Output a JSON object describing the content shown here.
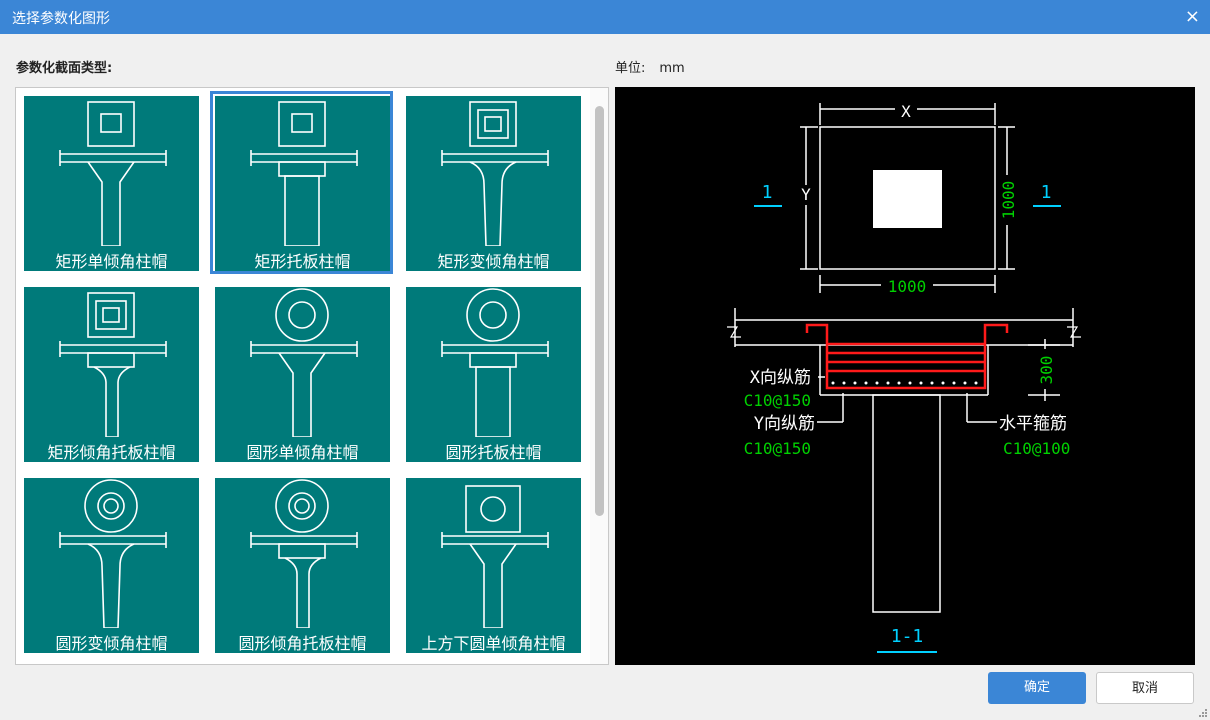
{
  "window": {
    "title": "选择参数化图形",
    "close_glyph": "×"
  },
  "section_label": "参数化截面类型:",
  "unit": {
    "label": "单位:",
    "value": "mm"
  },
  "tiles": [
    {
      "label": "矩形单倾角柱帽",
      "shape": "rect-tilt"
    },
    {
      "label": "矩形托板柱帽",
      "shape": "rect-plate",
      "selected": true
    },
    {
      "label": "矩形变倾角柱帽",
      "shape": "rect-vartilt"
    },
    {
      "label": "矩形倾角托板柱帽",
      "shape": "rect-tilt-plate"
    },
    {
      "label": "圆形单倾角柱帽",
      "shape": "circle-tilt"
    },
    {
      "label": "圆形托板柱帽",
      "shape": "circle-plate"
    },
    {
      "label": "圆形变倾角柱帽",
      "shape": "circle-vartilt"
    },
    {
      "label": "圆形倾角托板柱帽",
      "shape": "circle-tilt-plate"
    },
    {
      "label": "上方下圆单倾角柱帽",
      "shape": "square-circle-tilt"
    }
  ],
  "preview": {
    "dim_x": "X",
    "dim_y": "Y",
    "dim_width": "1000",
    "dim_height": "1000",
    "section_marker": "1",
    "dim_depth": "300",
    "x_rebar_label": "X向纵筋",
    "x_rebar_spec": "C10@150",
    "y_rebar_label": "Y向纵筋",
    "y_rebar_spec": "C10@150",
    "stirrup_label": "水平箍筋",
    "stirrup_spec": "C10@100",
    "section_title": "1-1"
  },
  "colors": {
    "accent": "#3b86d6",
    "tile_bg": "#007a7a",
    "dim_green": "#00d000",
    "rebar_red": "#ff1a1a",
    "marker_cyan": "#00d0ff"
  },
  "buttons": {
    "ok": "确定",
    "cancel": "取消"
  }
}
